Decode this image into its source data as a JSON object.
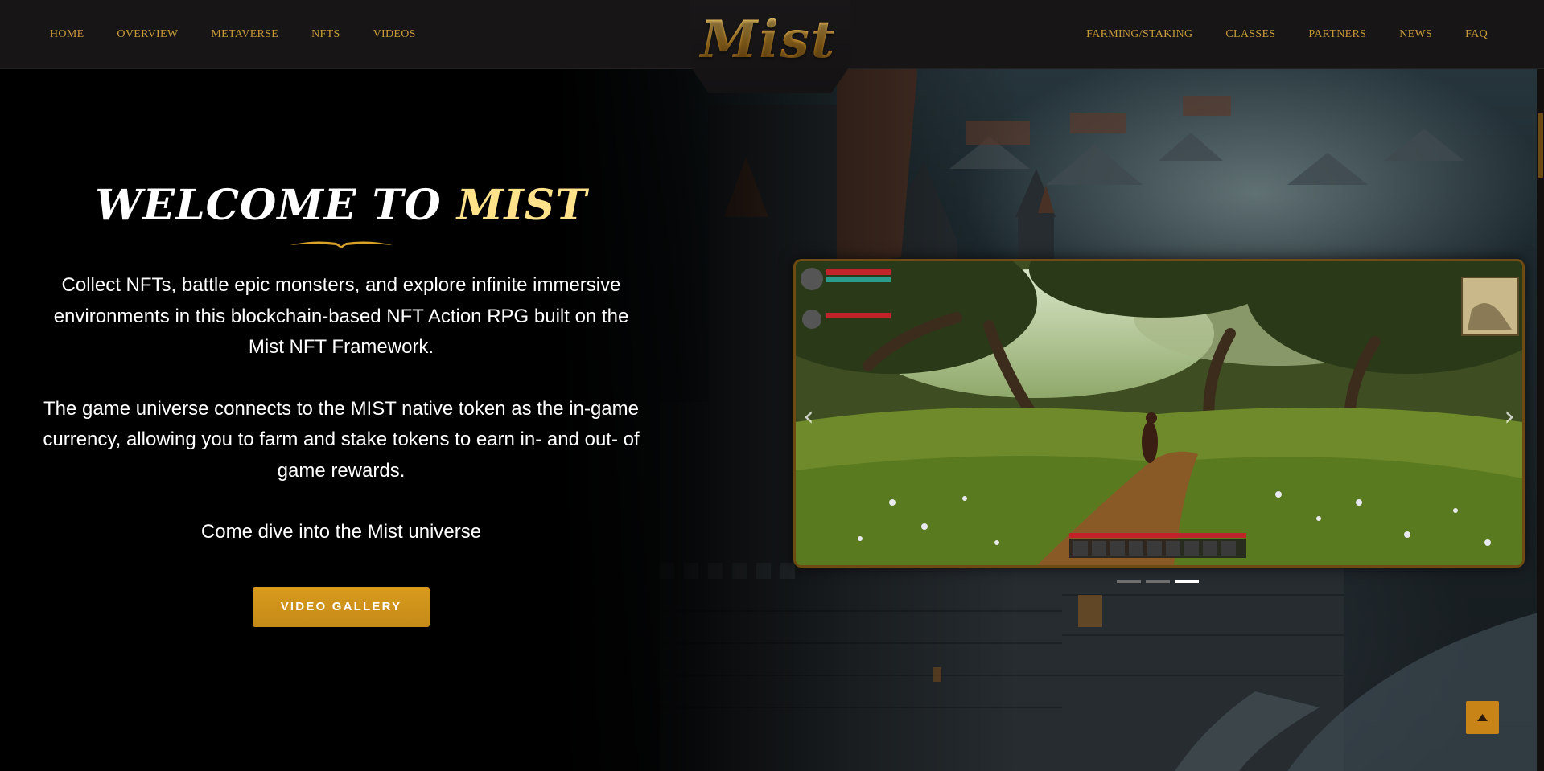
{
  "header": {
    "logo": "Mist",
    "nav_left": [
      "HOME",
      "OVERVIEW",
      "METAVERSE",
      "NFTS",
      "VIDEOS"
    ],
    "nav_right": [
      "FARMING/STAKING",
      "CLASSES",
      "PARTNERS",
      "NEWS",
      "FAQ"
    ]
  },
  "hero": {
    "title_part1": "WELCOME TO ",
    "title_accent": "MIST",
    "paragraph1": "Collect NFTs, battle epic monsters, and explore infinite immersive environments in this blockchain-based NFT Action RPG built on the Mist NFT Framework.",
    "paragraph2": "The game universe connects to the MIST native token as the in-game currency, allowing you to farm and stake tokens to earn in- and out- of game rewards.",
    "paragraph3": "Come dive into the Mist universe",
    "button_label": "VIDEO GALLERY"
  },
  "carousel": {
    "prev_icon": "‹",
    "next_icon": "›",
    "slide_count": 3,
    "active_slide": 3
  },
  "colors": {
    "accent_gold": "#c79a3a",
    "button_gold": "#d99b1d",
    "title_accent": "#ffe28a",
    "header_bg": "#171516"
  }
}
